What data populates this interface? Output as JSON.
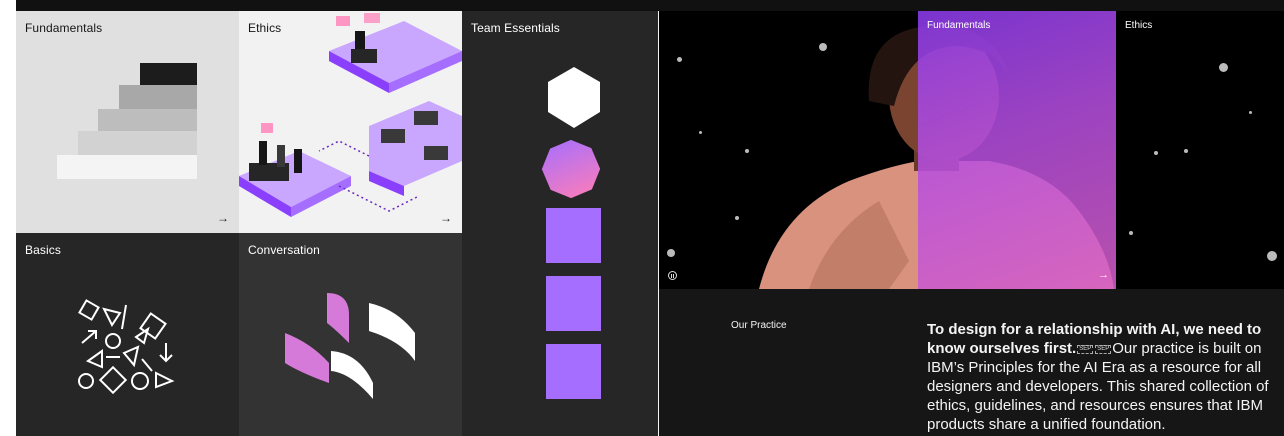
{
  "tiles": {
    "fundamentals": {
      "label": "Fundamentals",
      "arrow": "→"
    },
    "ethics": {
      "label": "Ethics",
      "arrow": "→"
    },
    "team": {
      "label": "Team Essentials"
    },
    "basics": {
      "label": "Basics"
    },
    "conversation": {
      "label": "Conversation"
    }
  },
  "hero": {
    "fundamentals_label": "Fundamentals",
    "ethics_label": "Ethics",
    "arrow": "→",
    "pause_icon": "pause-icon"
  },
  "practice": {
    "label": "Our Practice",
    "headline": "To design for a relationship with AI, we need to know ourselves first.",
    "sep1": "SEP",
    "sep2": "SEP",
    "body": "Our practice is built on IBM’s Principles for the AI Era as a resource for all designers and developers. This shared collection of ethics, guidelines, and resources ensures that IBM products share a unified foundation."
  },
  "colors": {
    "accent_purple": "#a56eff",
    "overlay_start": "#8e3cf0",
    "overlay_end": "#d65ec8"
  }
}
